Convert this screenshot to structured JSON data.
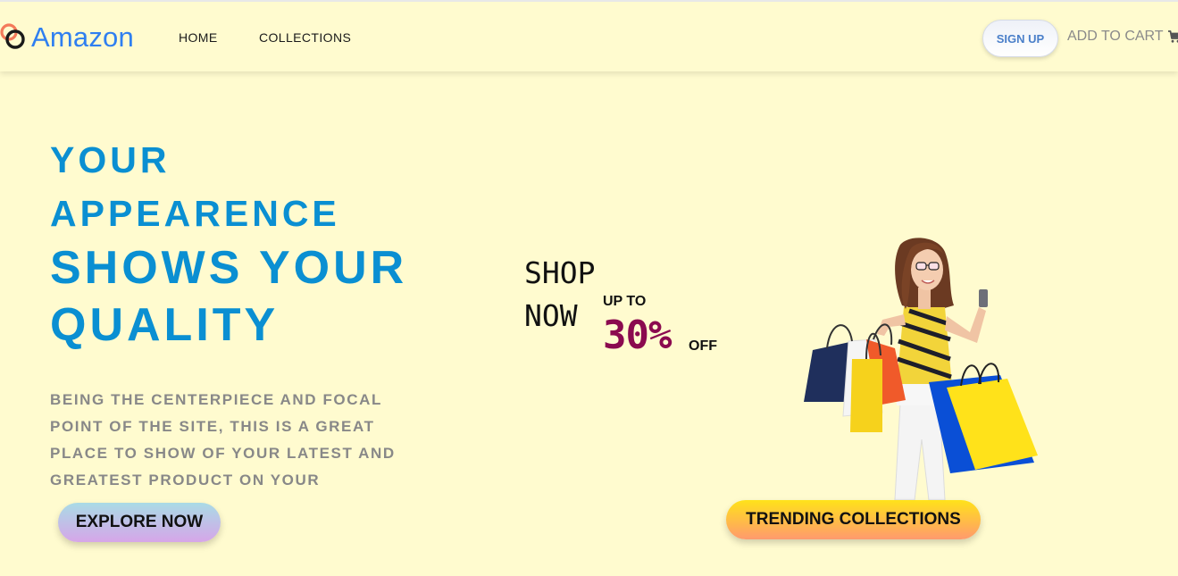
{
  "navbar": {
    "brand": "Amazon",
    "links": [
      "HOME",
      "COLLECTIONS"
    ],
    "signup_label": "SIGN UP",
    "cart_label": "ADD TO CART",
    "brand_color": "#2f7ff0",
    "cart_icon": "shopping-cart-icon",
    "logo_icon": "interlinked-rings-logo"
  },
  "hero": {
    "headline": [
      "YOUR",
      "APPEARENCE",
      "SHOWS YOUR",
      "QUALITY"
    ],
    "description": [
      "BEING THE CENTERPIECE AND FOCAL",
      "POINT OF THE SITE, THIS IS A GREAT",
      "PLACE TO SHOW OF YOUR LATEST AND",
      "GREATEST PRODUCT ON YOUR"
    ],
    "cta_label": "EXPLORE NOW",
    "headline_color": "#0a8fd2"
  },
  "promo": {
    "shop": "SHOP",
    "now": "NOW",
    "up_to": "UP TO",
    "percent": "30%",
    "off": "OFF",
    "percent_color": "#8b0a4f",
    "image": "woman-with-shopping-bags",
    "trending_label": "TRENDING COLLECTIONS"
  },
  "colors": {
    "background": "#fffbcf"
  }
}
